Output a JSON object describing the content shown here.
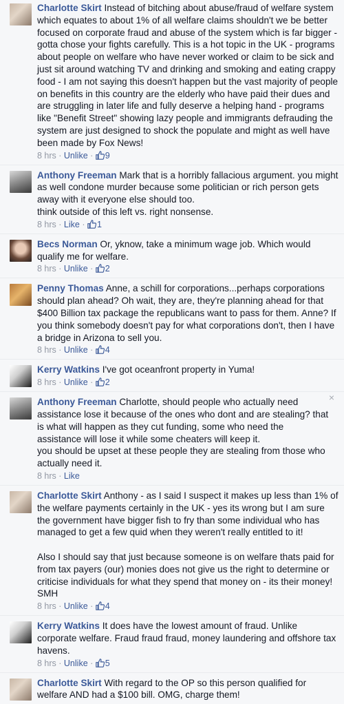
{
  "comments": [
    {
      "name": "Charlotte Skirt",
      "text": "Instead of bitching about abuse/fraud of welfare system which equates to about 1% of all welfare claims shouldn't we be better focused on corporate fraud and abuse of the system which is far bigger - gotta chose your fights carefully. This is a hot topic in the UK - programs about people on welfare who have never worked or claim to be sick and just sit around watching TV and drinking and smoking and eating crappy food - I am not saying this doesn't happen but the vast majority of people on benefits in this country are the elderly who have paid their dues and are struggling in later life and fully deserve a helping hand - programs like \"Benefit Street\" showing lazy people and immigrants defrauding the system are just designed to shock the populate and might as well have been made by Fox News!",
      "time": "8 hrs",
      "action": "Unlike",
      "likes": "9"
    },
    {
      "name": "Anthony Freeman",
      "text": "Mark that is a horribly fallacious argument. you might as well condone murder because some politician or rich person gets away with it everyone else should too.",
      "text2": "think outside of this left vs. right nonsense.",
      "time": "8 hrs",
      "action": "Like",
      "likes": "1"
    },
    {
      "name": "Becs Norman",
      "text": "Or, yknow, take a minimum wage job. Which would qualify me for welfare.",
      "time": "8 hrs",
      "action": "Unlike",
      "likes": "2"
    },
    {
      "name": "Penny Thomas",
      "text": "Anne, a schill for corporations...perhaps corporations should plan ahead? Oh wait, they are, they're planning ahead for that $400 Billion tax package the republicans want to pass for them. Anne? If you think somebody doesn't pay for what corporations don't, then I have a bridge in Arizona to sell you.",
      "time": "8 hrs",
      "action": "Unlike",
      "likes": "4"
    },
    {
      "name": "Kerry Watkins",
      "text": "I've got oceanfront property in Yuma!",
      "time": "8 hrs",
      "action": "Unlike",
      "likes": "2"
    },
    {
      "name": "Anthony Freeman",
      "text": "Charlotte, should people who actually need assistance lose it because of the ones who dont and are stealing? that is what will happen as they cut funding, some who need the assistance will lose it while some cheaters will keep it.",
      "text2": "you should be upset at these people they are stealing from those who actually need it.",
      "time": "8 hrs",
      "action": "Like",
      "close": "×"
    },
    {
      "name": "Charlotte Skirt",
      "text": "Anthony - as I said I suspect it makes up less than 1% of the welfare payments certainly in the UK - yes its wrong but I am sure the government have bigger fish to fry than some individual who has managed to get a few quid when they weren't really entitled to it!",
      "text2": "Also I should say that just because someone is on welfare thats paid for from tax payers (our) monies does not give us the right to determine or criticise individuals for what they spend that money on - its their money! SMH",
      "time": "8 hrs",
      "action": "Unlike",
      "likes": "4"
    },
    {
      "name": "Kerry Watkins",
      "text": "It does have the lowest amount of fraud. Unlike corporate welfare. Fraud fraud fraud, money laundering and offshore tax havens.",
      "time": "8 hrs",
      "action": "Unlike",
      "likes": "5"
    },
    {
      "name": "Charlotte Skirt",
      "text": "With regard to the OP so this person qualified for welfare AND had a $100 bill. OMG, charge them!"
    }
  ]
}
